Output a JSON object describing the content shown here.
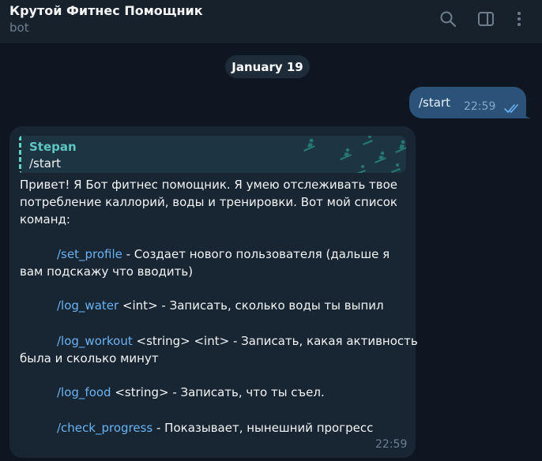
{
  "header": {
    "title": "Крутой Фитнес Помощник",
    "subtitle": "bot",
    "icons": [
      "search-icon",
      "sidebar-toggle-icon",
      "more-vertical-icon"
    ]
  },
  "chat": {
    "date": "January 19",
    "outgoing": {
      "text": "/start",
      "time": "22:59",
      "status": "read"
    },
    "incoming": {
      "reply": {
        "name": "Stepan",
        "text": "/start"
      },
      "intro_lines": [
        "Привет! Я Бот фитнес помощник. Я умею отслеживать твое",
        "потребление каллорий, воды и тренировки. Вот мой список",
        "команд:"
      ],
      "commands": [
        {
          "command": "/set_profile",
          "args": "",
          "desc_line1": " - Создает нового пользователя (дальше я",
          "desc_line2": "вам подскажу что вводить)"
        },
        {
          "command": "/log_water",
          "args": " <int>",
          "desc_line1": " - Записать, сколько воды ты выпил",
          "desc_line2": ""
        },
        {
          "command": "/log_workout",
          "args": " <string> <int>",
          "desc_line1": " - Записать, какая активность",
          "desc_line2": "была и сколько минут"
        },
        {
          "command": "/log_food",
          "args": " <string>",
          "desc_line1": " - Записать, что ты съел.",
          "desc_line2": ""
        },
        {
          "command": "/check_progress",
          "args": "",
          "desc_line1": " - Показывает, нынешний прогресс",
          "desc_line2": ""
        }
      ],
      "time": "22:59"
    }
  },
  "colors": {
    "background": "#0e1621",
    "header": "#17212b",
    "outgoing_bubble": "#2b5278",
    "incoming_bubble": "#182533",
    "link": "#6ab3f3",
    "reply_accent": "#5ec6c3"
  }
}
